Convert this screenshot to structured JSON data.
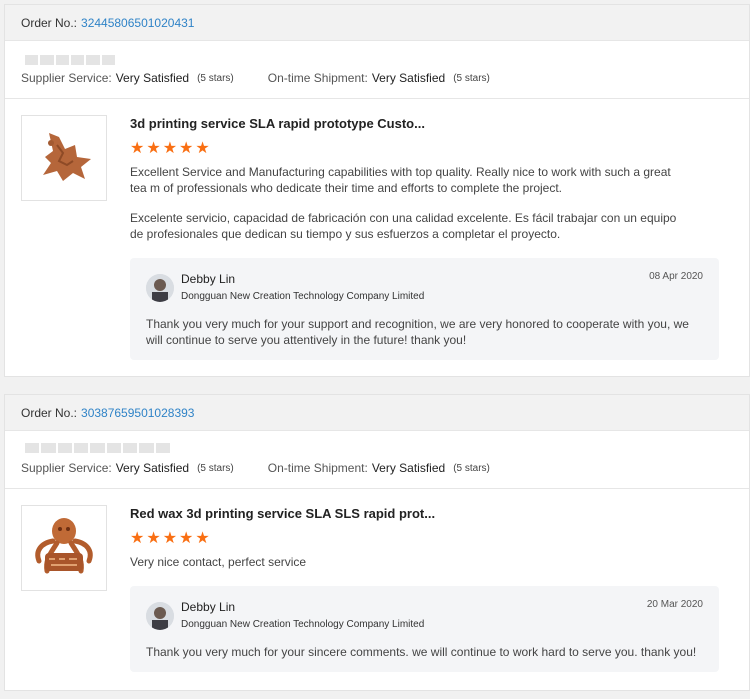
{
  "orders": [
    {
      "order_label": "Order No.:",
      "order_number": "32445806501020431",
      "supplier_label": "Supplier Service:",
      "supplier_value": "Very Satisfied",
      "supplier_stars": "(5 stars)",
      "shipment_label": "On-time Shipment:",
      "shipment_value": "Very Satisfied",
      "shipment_stars": "(5 stars)",
      "product_title": "3d printing service SLA rapid prototype Custo...",
      "rating": 5,
      "stars_text": "★★★★★",
      "review_en": "Excellent Service and Manufacturing capabilities with top quality. Really nice to work with such a great tea m of professionals who dedicate their time and efforts to complete the project.",
      "review_es": "Excelente servicio, capacidad de fabricación con una calidad excelente. Es fácil trabajar con un equipo de profesionales que dedican su tiempo y sus esfuerzos a completar el proyecto.",
      "reply": {
        "name": "Debby Lin",
        "company": "Dongguan New Creation Technology Company Limited",
        "date": "08 Apr 2020",
        "text": "Thank you very much for your support and recognition, we are very honored to cooperate with you, we will continue to serve you attentively in the future! thank you!"
      }
    },
    {
      "order_label": "Order No.:",
      "order_number": "30387659501028393",
      "supplier_label": "Supplier Service:",
      "supplier_value": "Very Satisfied",
      "supplier_stars": "(5 stars)",
      "shipment_label": "On-time Shipment:",
      "shipment_value": "Very Satisfied",
      "shipment_stars": "(5 stars)",
      "product_title": "Red wax 3d printing service SLA SLS rapid prot...",
      "rating": 5,
      "stars_text": "★★★★★",
      "review_en": "Very nice contact, perfect service",
      "reply": {
        "name": "Debby Lin",
        "company": "Dongguan New Creation Technology Company Limited",
        "date": "20 Mar 2020",
        "text": "Thank you very much for your sincere comments. we will continue to work hard to serve you. thank you!"
      }
    }
  ],
  "product_images": [
    "dragon-model-image",
    "octopus-model-image"
  ],
  "colors": {
    "accent_link": "#2f83c7",
    "star": "#f96f13",
    "model_brown": "#b5663a"
  }
}
